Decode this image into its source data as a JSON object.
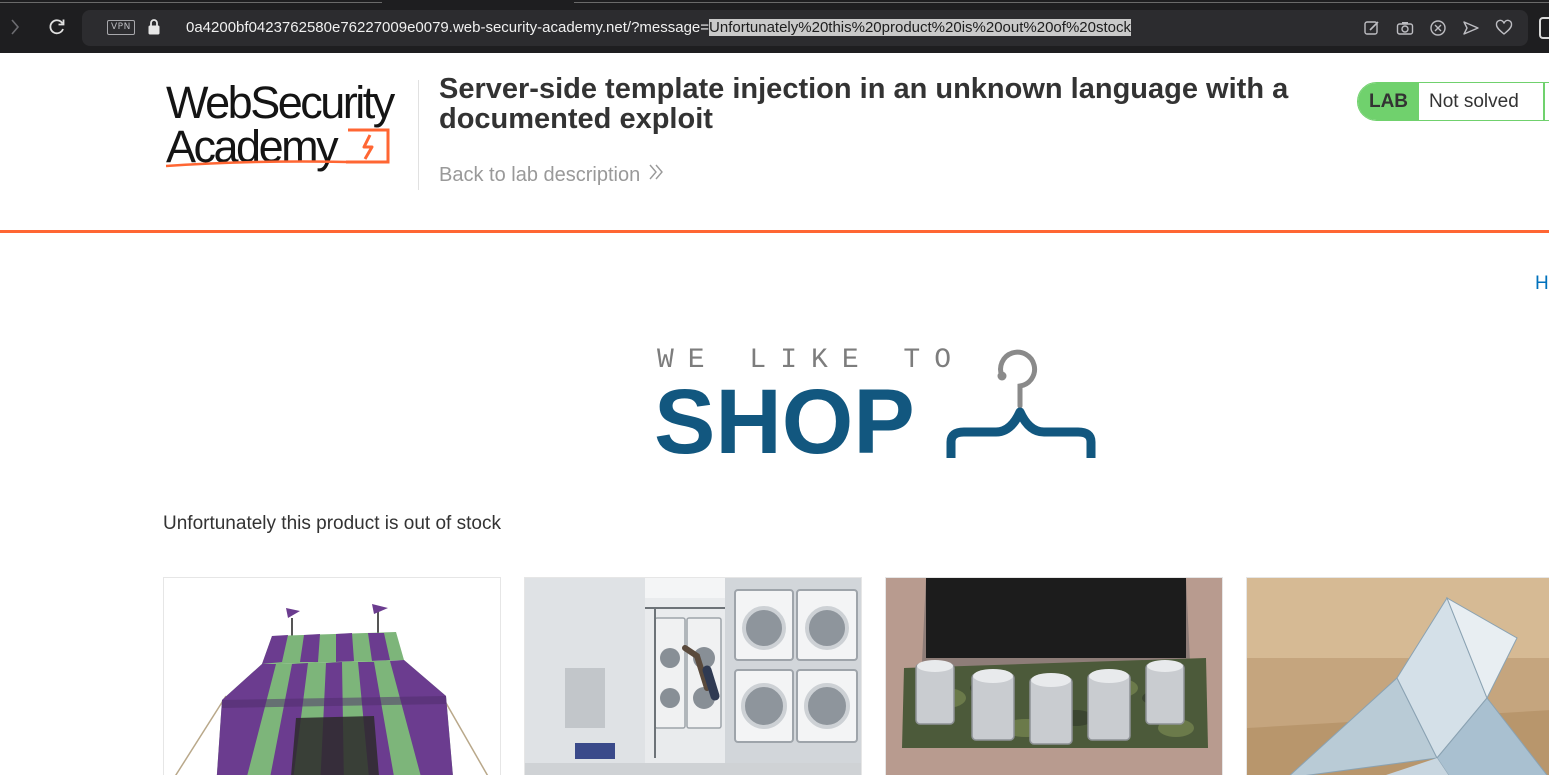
{
  "browser": {
    "vpn_label": "VPN",
    "url_host": "0a4200bf0423762580e76227009e0079.web-security-academy.net/?message=",
    "url_query_selected": "Unfortunately%20this%20product%20is%20out%20of%20stock",
    "icons": [
      "back-arrow-icon",
      "reload-icon",
      "lock-icon",
      "edit-icon",
      "camera-icon",
      "block-icon",
      "send-icon",
      "heart-icon"
    ]
  },
  "header": {
    "logo_line1": "WebSecurity",
    "logo_line2": "Academy",
    "lab_title": "Server-side template injection in an unknown language with a documented exploit",
    "back_link": "Back to lab description",
    "lab_badge": "LAB",
    "lab_status": "Not solved",
    "colors": {
      "accent": "#ff6633",
      "lab_green": "#70d16d"
    }
  },
  "nav": {
    "home_partial": "H"
  },
  "hero": {
    "tagline": "WE LIKE TO",
    "word": "SHOP",
    "colors": {
      "word": "#12577f",
      "tagline": "#7d7d7d"
    }
  },
  "message": "Unfortunately this product is out of stock",
  "products": [
    {
      "image": "striped-tent-image"
    },
    {
      "image": "laundromat-image"
    },
    {
      "image": "beer-belt-image"
    },
    {
      "image": "paper-boat-image"
    }
  ]
}
